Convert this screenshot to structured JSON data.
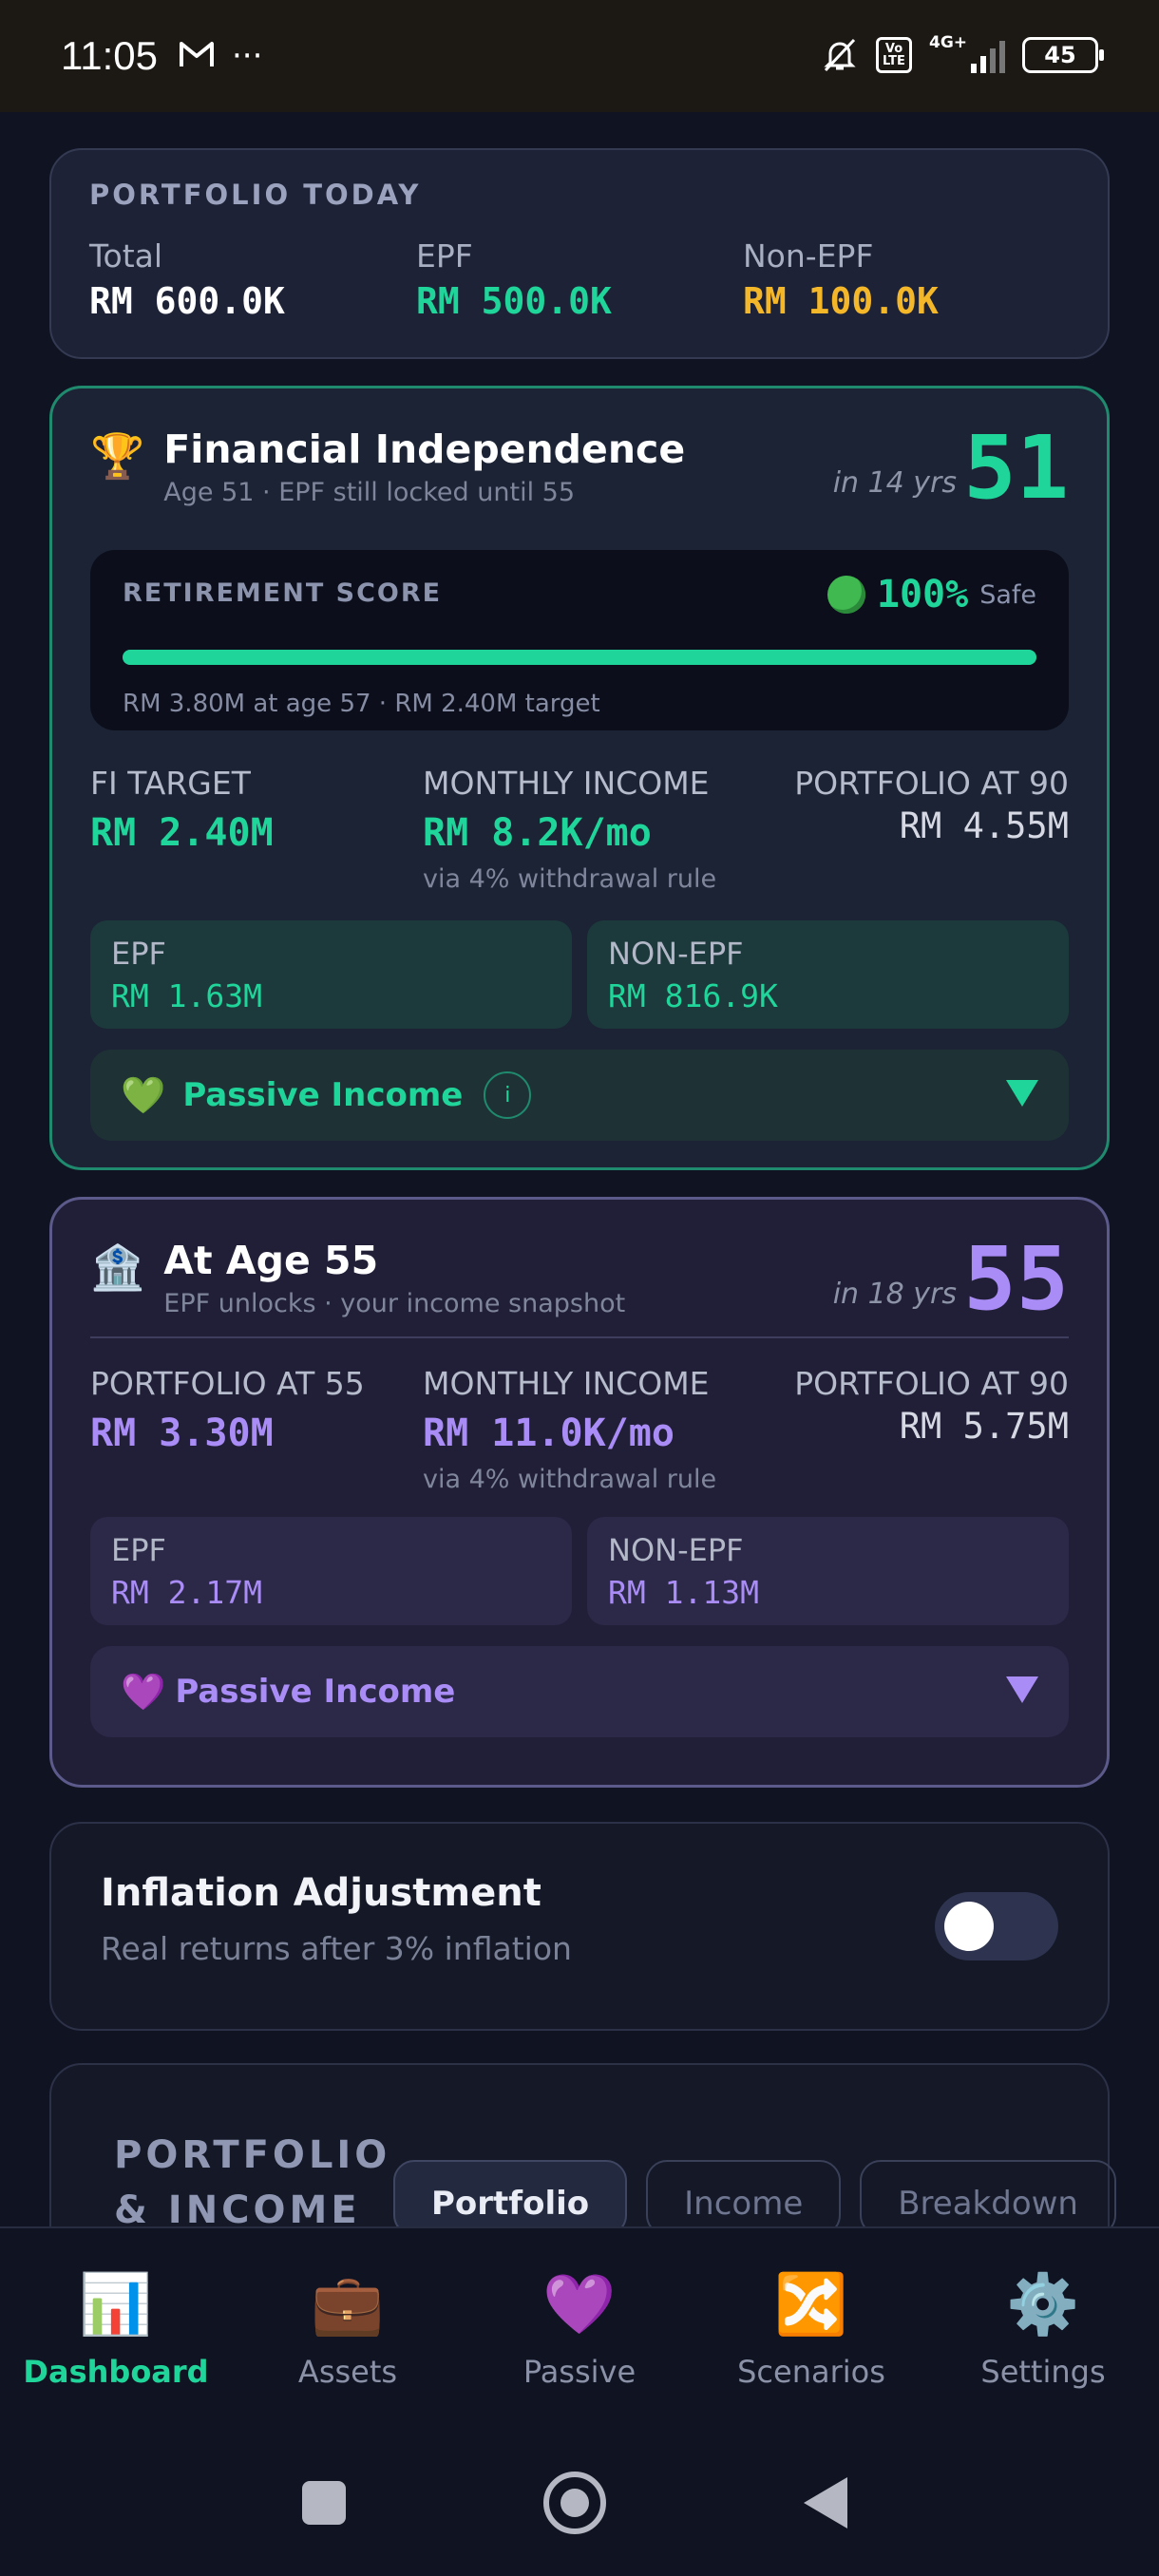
{
  "status_bar": {
    "time": "11:05",
    "network": "4G+",
    "volte": "Vo LTE",
    "battery": "45"
  },
  "portfolio_today": {
    "header": "PORTFOLIO TODAY",
    "items": [
      {
        "label": "Total",
        "value": "RM 600.0K",
        "color": "#ffffff"
      },
      {
        "label": "EPF",
        "value": "RM 500.0K",
        "color": "#20d59a"
      },
      {
        "label": "Non-EPF",
        "value": "RM 100.0K",
        "color": "#f5b72a"
      }
    ]
  },
  "fi_card": {
    "icon": "trophy-icon",
    "title": "Financial Independence",
    "subtitle": "Age 51 · EPF still locked until 55",
    "in_years": "in 14 yrs",
    "age": "51",
    "accent": "#20d59a",
    "score": {
      "label": "RETIREMENT SCORE",
      "percent": "100%",
      "percent_value": 100,
      "status": "Safe",
      "note": "RM 3.80M at age 57 · RM 2.40M target"
    },
    "metrics": [
      {
        "label": "FI TARGET",
        "value": "RM 2.40M",
        "hint": ""
      },
      {
        "label": "MONTHLY INCOME",
        "value": "RM 8.2K/mo",
        "hint": "via 4% withdrawal rule"
      },
      {
        "label": "PORTFOLIO AT 90",
        "value": "RM 4.55M",
        "hint": ""
      }
    ],
    "split": [
      {
        "label": "EPF",
        "value": "RM 1.63M"
      },
      {
        "label": "NON-EPF",
        "value": "RM 816.9K"
      }
    ],
    "passive": {
      "icon": "green-heart-icon",
      "label": "Passive Income",
      "info": "i"
    }
  },
  "age55_card": {
    "icon": "bank-icon",
    "title": "At Age 55",
    "subtitle": "EPF unlocks · your income snapshot",
    "in_years": "in 18 yrs",
    "age": "55",
    "accent": "#a98cf5",
    "metrics": [
      {
        "label": "PORTFOLIO AT 55",
        "value": "RM 3.30M",
        "hint": ""
      },
      {
        "label": "MONTHLY INCOME",
        "value": "RM 11.0K/mo",
        "hint": "via 4% withdrawal rule"
      },
      {
        "label": "PORTFOLIO AT 90",
        "value": "RM 5.75M",
        "hint": ""
      }
    ],
    "split": [
      {
        "label": "EPF",
        "value": "RM 2.17M"
      },
      {
        "label": "NON-EPF",
        "value": "RM 1.13M"
      }
    ],
    "passive": {
      "icon": "purple-heart-icon",
      "label": "Passive Income"
    }
  },
  "inflation": {
    "title": "Inflation Adjustment",
    "subtitle": "Real returns after 3% inflation",
    "enabled": false
  },
  "portfolio_income": {
    "header_line1": "PORTFOLIO",
    "header_line2": "& INCOME",
    "tabs": [
      "Portfolio",
      "Income",
      "Breakdown"
    ],
    "active_tab": "Portfolio"
  },
  "bottom_nav": [
    {
      "icon": "bar-chart-icon",
      "glyph": "📊",
      "label": "Dashboard",
      "active": true
    },
    {
      "icon": "briefcase-icon",
      "glyph": "💼",
      "label": "Assets",
      "active": false
    },
    {
      "icon": "purple-heart-icon",
      "glyph": "💜",
      "label": "Passive",
      "active": false
    },
    {
      "icon": "shuffle-icon",
      "glyph": "🔀",
      "label": "Scenarios",
      "active": false
    },
    {
      "icon": "gear-icon",
      "glyph": "⚙️",
      "label": "Settings",
      "active": false
    }
  ]
}
